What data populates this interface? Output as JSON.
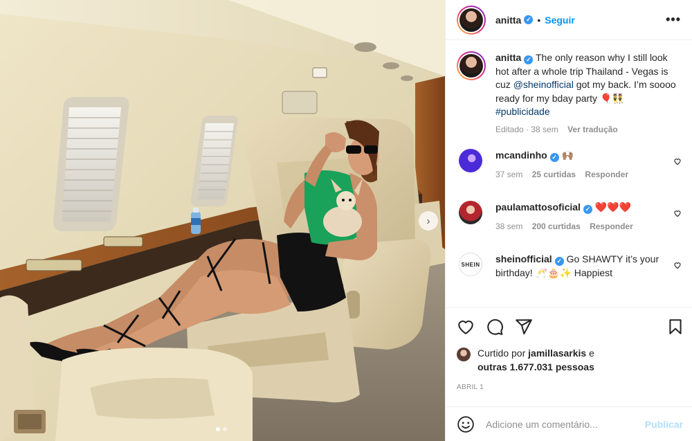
{
  "post": {
    "username": "anitta",
    "follow_label": "Seguir",
    "separator": "•",
    "more_label": "•••"
  },
  "caption": {
    "username": "anitta",
    "text_a": "The only reason why I still look hot after a whole trip Thailand - Vegas is cuz ",
    "mention": "@sheinofficial",
    "text_b": " got my back. I’m soooo ready for my bday party 🎈👯 ",
    "hashtag": "#publicidade",
    "edited": "Editado · 38 sem",
    "translate": "Ver tradução"
  },
  "comments": [
    {
      "username": "mcandinho",
      "text": "🙌🏽",
      "time": "37 sem",
      "likes": "25 curtidas",
      "reply": "Responder"
    },
    {
      "username": "paulamattosoficial",
      "text": "❤️❤️❤️",
      "time": "38 sem",
      "likes": "200 curtidas",
      "reply": "Responder"
    },
    {
      "username": "sheinofficial",
      "text": "Go SHAWTY it’s your birthday! 🥂🎂✨ Happiest",
      "avatar_text": "SHEIN"
    }
  ],
  "likes": {
    "prefix": "Curtido por ",
    "user": "jamillasarkis",
    "mid": " e",
    "others": "outras 1.677.031 pessoas"
  },
  "date": "ABRIL 1",
  "add_comment": {
    "placeholder": "Adicione um comentário...",
    "post_label": "Publicar"
  },
  "carousel": {
    "next": "›",
    "count": 2,
    "active": 0
  },
  "icons": [
    "heart-icon",
    "comment-icon",
    "share-icon",
    "bookmark-icon",
    "emoji-icon",
    "verified-badge-icon",
    "more-icon"
  ],
  "colors": {
    "link": "#0095f6",
    "mention": "#00376b",
    "muted": "#8e8e8e",
    "publish_disabled": "#b2dffc",
    "verified": "#3897f0"
  }
}
